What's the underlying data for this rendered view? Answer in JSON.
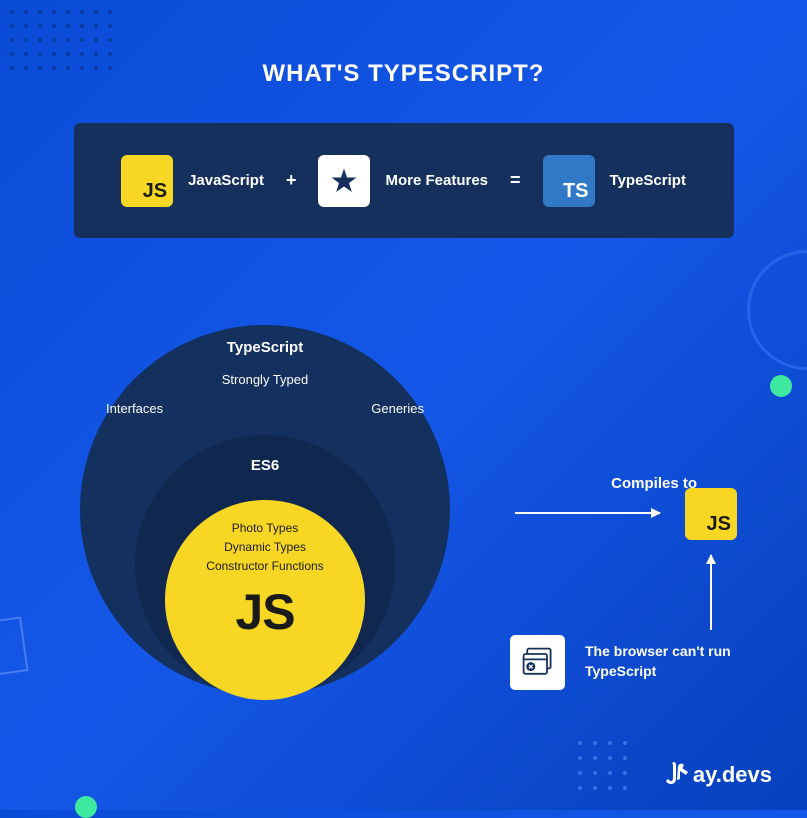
{
  "title": "WHAT'S TYPESCRIPT?",
  "equation": {
    "item1": {
      "icon": "JS",
      "label": "JavaScript"
    },
    "op1": "+",
    "item2": {
      "icon": "star",
      "label": "More Features"
    },
    "op2": "=",
    "item3": {
      "icon": "TS",
      "label": "TypeScript"
    }
  },
  "venn": {
    "outer": {
      "title": "TypeScript",
      "sub": "Strongly Typed",
      "left": "Interfaces",
      "right": "Generies"
    },
    "mid": {
      "title": "ES6"
    },
    "inner": {
      "line1": "Photo Types",
      "line2": "Dynamic Types",
      "line3": "Constructor Functions",
      "big": "JS"
    }
  },
  "flow": {
    "compiles": "Compiles to",
    "target_icon": "JS",
    "browser_msg": "The browser can't run TypeScript"
  },
  "brand": "ay.devs"
}
